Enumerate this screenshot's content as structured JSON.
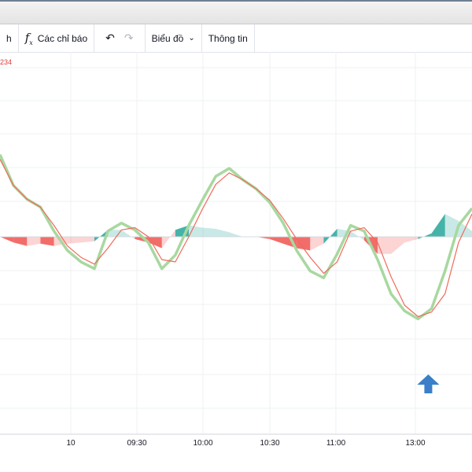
{
  "toolbar": {
    "cut_item": "h",
    "indicators_label": "Các chỉ báo",
    "fx_symbol": "f",
    "fx_sub": "x",
    "chart_label": "Biểu đồ",
    "info_label": "Thông tin"
  },
  "legend_fragment": "234",
  "colors": {
    "fast_line": "#a8d8a0",
    "slow_line": "#ef6a5a",
    "hist_pos": "#26a69a",
    "hist_neg": "#ef5350",
    "arrow": "#3a7fc8",
    "grid": "#eef0f3"
  },
  "chart_data": {
    "type": "line",
    "x_ticks": [
      "10",
      "09:30",
      "10:00",
      "10:30",
      "11:00",
      "13:00"
    ],
    "ylim": [
      -1,
      1
    ],
    "grid": true,
    "series": [
      {
        "values": [
          0.72,
          0.45,
          0.33,
          0.26,
          0.05,
          -0.12,
          -0.22,
          -0.28,
          0.05,
          0.12,
          0.06,
          -0.05,
          -0.28,
          -0.16,
          0.1,
          0.32,
          0.53,
          0.6,
          0.5,
          0.42,
          0.3,
          0.12,
          -0.12,
          -0.3,
          -0.36,
          -0.15,
          0.1,
          0.05,
          -0.2,
          -0.5,
          -0.65,
          -0.72,
          -0.63,
          -0.3,
          0.1,
          0.25
        ]
      },
      {
        "values": [
          0.68,
          0.45,
          0.33,
          0.26,
          0.1,
          -0.08,
          -0.18,
          -0.24,
          -0.1,
          0.06,
          0.08,
          0.0,
          -0.2,
          -0.22,
          0.0,
          0.24,
          0.46,
          0.56,
          0.5,
          0.42,
          0.32,
          0.16,
          -0.02,
          -0.18,
          -0.32,
          -0.22,
          0.05,
          0.08,
          -0.05,
          -0.35,
          -0.6,
          -0.7,
          -0.66,
          -0.5,
          -0.05,
          0.2
        ]
      }
    ],
    "histogram": [
      0.0,
      -0.05,
      -0.08,
      -0.06,
      -0.08,
      -0.06,
      -0.05,
      -0.04,
      0.06,
      0.06,
      -0.02,
      -0.05,
      -0.1,
      0.06,
      0.1,
      0.08,
      0.07,
      0.04,
      0.0,
      0.0,
      -0.02,
      -0.06,
      -0.1,
      -0.12,
      -0.06,
      0.07,
      0.05,
      -0.03,
      -0.15,
      -0.15,
      -0.05,
      -0.02,
      0.03,
      0.2,
      0.14,
      0.05
    ],
    "marker": {
      "type": "arrow-up",
      "at_index": 31
    }
  }
}
